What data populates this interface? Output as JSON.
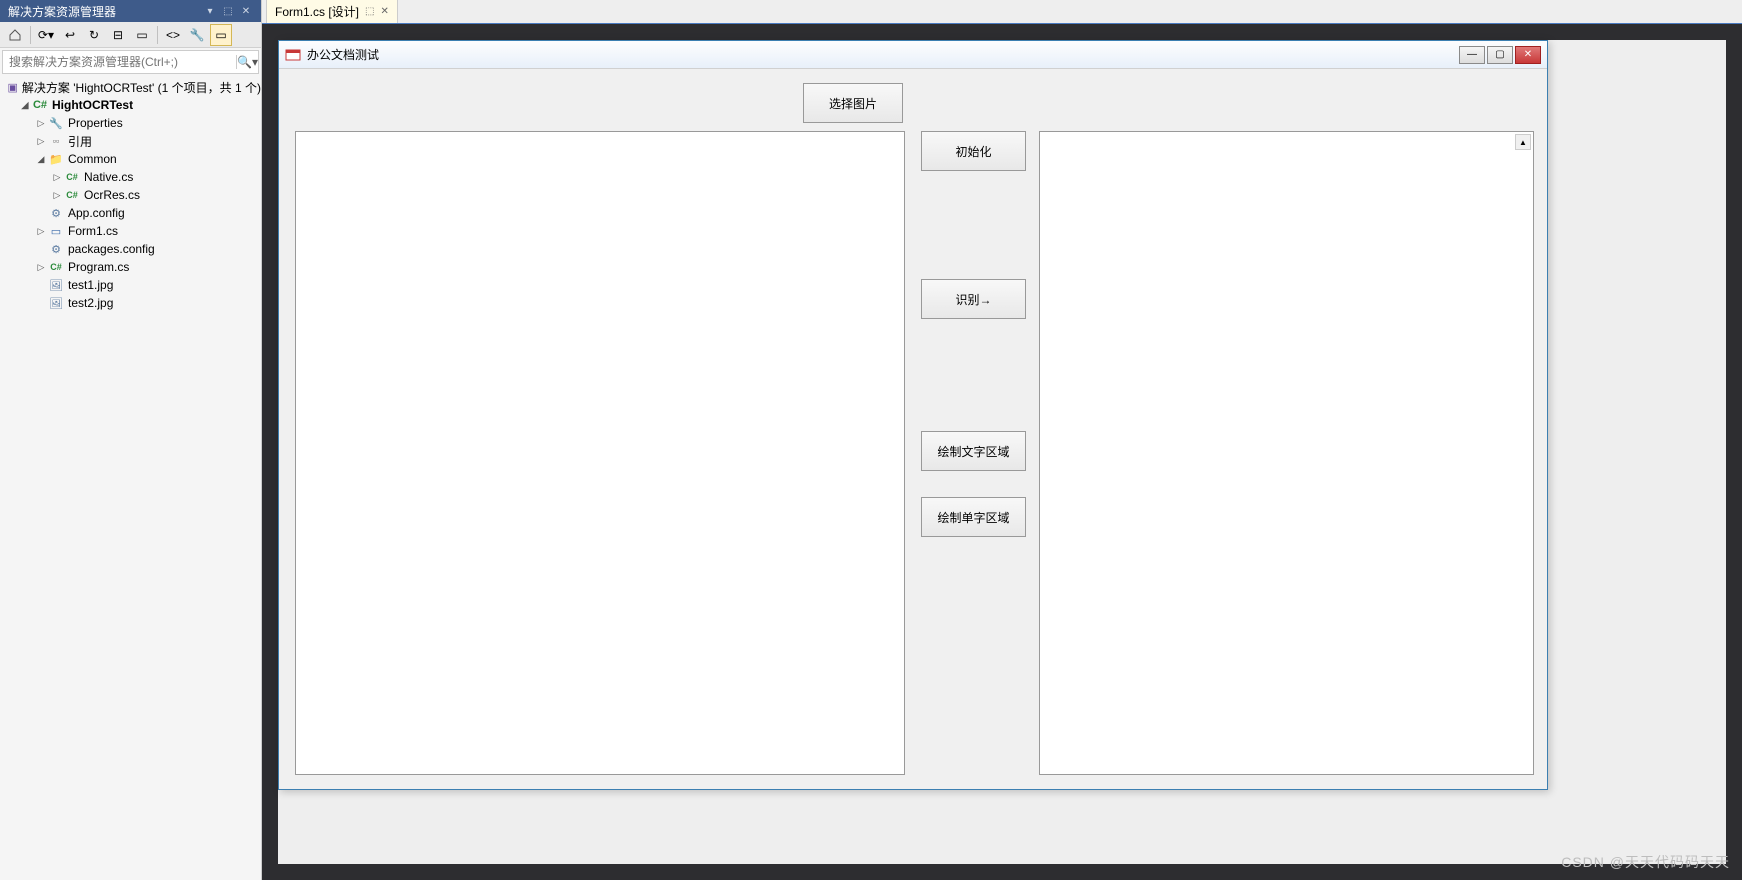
{
  "solutionExplorer": {
    "title": "解决方案资源管理器",
    "searchPlaceholder": "搜索解决方案资源管理器(Ctrl+;)",
    "solutionLabel": "解决方案 'HightOCRTest' (1 个项目，共 1 个)",
    "project": "HightOCRTest",
    "nodes": {
      "properties": "Properties",
      "references": "引用",
      "common": "Common",
      "native": "Native.cs",
      "ocrres": "OcrRes.cs",
      "appconfig": "App.config",
      "form1": "Form1.cs",
      "packages": "packages.config",
      "program": "Program.cs",
      "test1": "test1.jpg",
      "test2": "test2.jpg"
    }
  },
  "docTab": {
    "label": "Form1.cs [设计]"
  },
  "form": {
    "title": "办公文档测试",
    "buttons": {
      "selectImage": "选择图片",
      "init": "初始化",
      "recognize": "识别→",
      "drawTextArea": "绘制文字区域",
      "drawCharArea": "绘制单字区域"
    }
  },
  "watermark": "CSDN @天天代码码天天"
}
